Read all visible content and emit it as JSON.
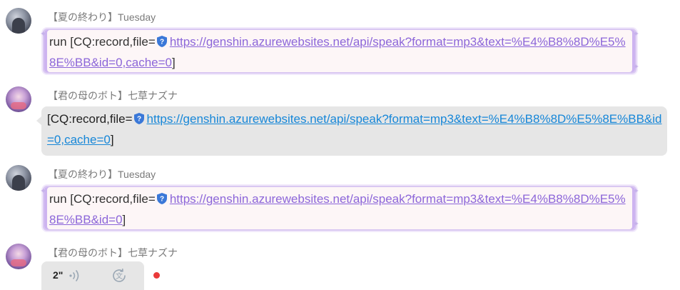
{
  "messages": [
    {
      "sender": "【夏の終わり】Tuesday",
      "prefix": "run [CQ:record,file=",
      "link": "https://genshin.azurewebsites.net/api/speak?format=mp3&text=%E4%B8%8D%E5%8E%BB&id=0,cache=0",
      "suffix": "]"
    },
    {
      "sender": "【君の母のボト】七草ナズナ",
      "prefix": "[CQ:record,file=",
      "link": "https://genshin.azurewebsites.net/api/speak?format=mp3&text=%E4%B8%8D%E5%8E%BB&id=0,cache=0",
      "suffix": "]"
    },
    {
      "sender": "【夏の終わり】Tuesday",
      "prefix": "run [CQ:record,file=",
      "link": "https://genshin.azurewebsites.net/api/speak?format=mp3&text=%E4%B8%8D%E5%8E%BB&id=0",
      "suffix": "]"
    },
    {
      "sender": "【君の母のボト】七草ナズナ",
      "voice_duration": "2\""
    }
  ],
  "icons": {
    "link_badge": "shield-question-icon",
    "voice_wave": "sound-wave-icon",
    "voice_translate": "translate-icon",
    "unread": "unread-dot-icon"
  },
  "colors": {
    "fancy_link": "#8c66d9",
    "gray_link": "#1787d8",
    "unread": "#ea3a3a"
  }
}
